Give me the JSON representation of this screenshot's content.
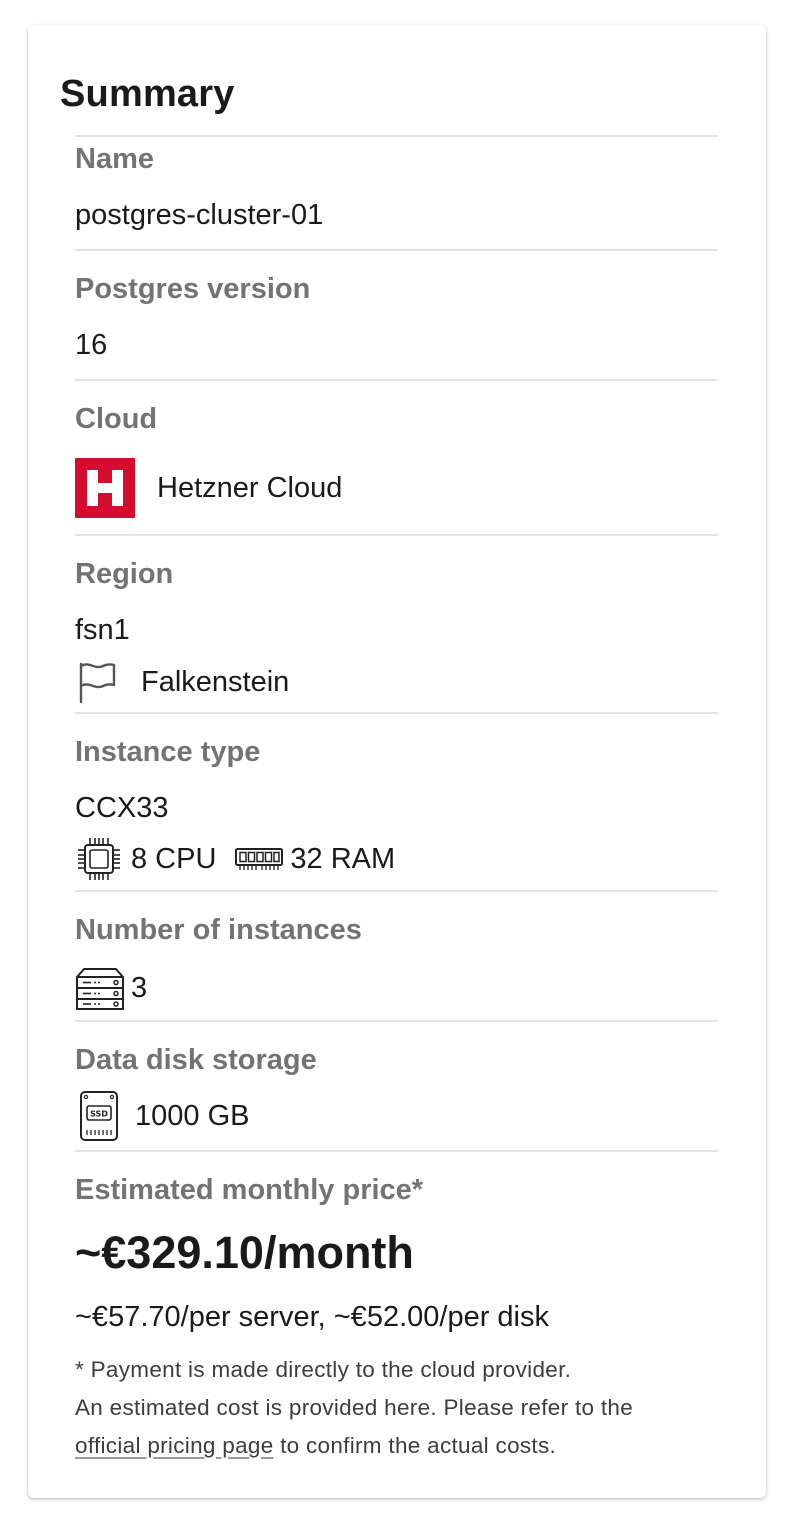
{
  "summary": {
    "title": "Summary",
    "name": {
      "label": "Name",
      "value": "postgres-cluster-01"
    },
    "postgres_version": {
      "label": "Postgres version",
      "value": "16"
    },
    "cloud": {
      "label": "Cloud",
      "value": "Hetzner Cloud",
      "logo_letter": "H",
      "logo_color": "#d50c2d",
      "icon": "hetzner-logo"
    },
    "region": {
      "label": "Region",
      "value": "fsn1",
      "location": "Falkenstein",
      "icon": "flag-icon"
    },
    "instance_type": {
      "label": "Instance type",
      "value": "CCX33",
      "cpu": "8 CPU",
      "ram": "32 RAM",
      "cpu_icon": "cpu-icon",
      "ram_icon": "ram-icon"
    },
    "instances": {
      "label": "Number of instances",
      "value": "3",
      "icon": "server-stack-icon"
    },
    "storage": {
      "label": "Data disk storage",
      "value": "1000 GB",
      "icon": "ssd-icon",
      "icon_text": "SSD"
    },
    "price": {
      "label": "Estimated monthly price*",
      "total": "~€329.10/month",
      "breakdown": "~€57.70/per server, ~€52.00/per disk",
      "note_line1": "* Payment is made directly to the cloud provider.",
      "note_line2": "An estimated cost is provided here. Please refer to the",
      "note_link": "official pricing page",
      "note_line3_rest": " to confirm the actual costs."
    }
  }
}
